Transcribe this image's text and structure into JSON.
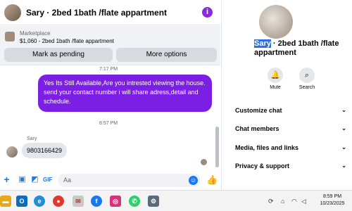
{
  "chat": {
    "title": "Sary · 2bed 1bath /flate appartment",
    "marketplace": {
      "label": "Marketplace",
      "listing": "$1,060 - 2bed 1bath /flate appartment",
      "mark_pending": "Mark as pending",
      "more_options": "More options"
    },
    "messages": {
      "time1": "7:17 PM",
      "outgoing": "Yes Its Still Available,Are you intrested viewing the house. send your contact number i will share adress,detail and schedule.",
      "time2": "8:57 PM",
      "sender": "Sary",
      "incoming": "9803166429"
    },
    "composer": {
      "placeholder": "Aa"
    }
  },
  "side": {
    "name_highlight": "Sary",
    "name_rest": " · 2bed 1bath /flate appartment",
    "mute": "Mute",
    "search": "Search",
    "sections": [
      "Customize chat",
      "Chat members",
      "Media, files and links",
      "Privacy & support"
    ]
  },
  "taskbar": {
    "time": "8:59 PM",
    "date": "10/23/2025"
  },
  "colors": {
    "accent": "#7b1fe4",
    "brand": "#1877f2"
  }
}
